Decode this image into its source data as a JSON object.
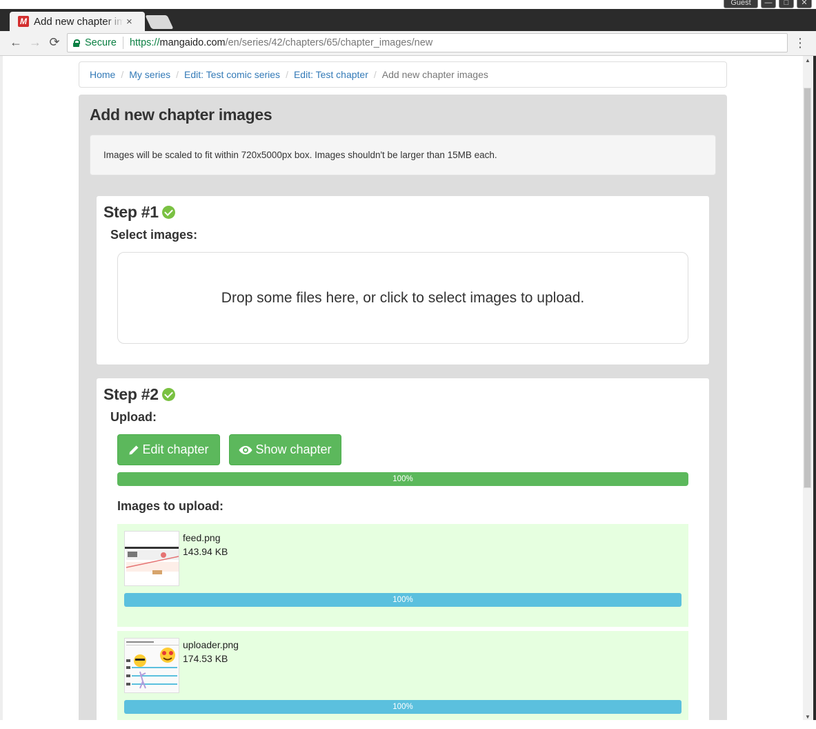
{
  "browser": {
    "tab_title": "Add new chapter images",
    "favicon_letter": "M",
    "tab_close": "×",
    "guest_label": "Guest",
    "secure_label": "Secure",
    "url_scheme": "https://",
    "url_host": "mangaido.com",
    "url_path": "/en/series/42/chapters/65/chapter_images/new"
  },
  "breadcrumb": {
    "home": "Home",
    "my_series": "My series",
    "edit_series": "Edit: Test comic series",
    "edit_chapter": "Edit: Test chapter",
    "current": "Add new chapter images",
    "divider": "/"
  },
  "page": {
    "title": "Add new chapter images",
    "info": "Images will be scaled to fit within 720x5000px box. Images shouldn't be larger than 15MB each."
  },
  "step1": {
    "title": "Step #1",
    "subtitle": "Select images:",
    "dropzone_text": "Drop some files here, or click to select images to upload."
  },
  "step2": {
    "title": "Step #2",
    "subtitle": "Upload:",
    "edit_button": "Edit chapter",
    "show_button": "Show chapter",
    "progress_label": "100%",
    "progress_fraction": 1.0,
    "images_heading": "Images to upload:",
    "images": [
      {
        "name": "feed.png",
        "size": "143.94 KB",
        "progress_label": "100%"
      },
      {
        "name": "uploader.png",
        "size": "174.53 KB",
        "progress_label": "100%"
      }
    ]
  },
  "colors": {
    "success": "#5cb85c",
    "info": "#5bc0de",
    "check": "#7ac142",
    "item_bg": "#e6ffe0",
    "link": "#337ab7"
  }
}
